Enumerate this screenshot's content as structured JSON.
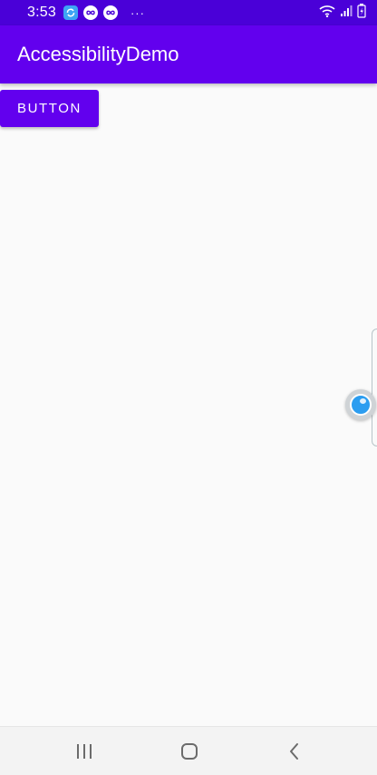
{
  "status_bar": {
    "time": "3:53",
    "more_glyph": "···",
    "icons": [
      "sync-icon",
      "infinity-icon",
      "infinity-icon",
      "wifi-icon",
      "signal-icon",
      "battery-icon"
    ]
  },
  "app_bar": {
    "title": "AccessibilityDemo"
  },
  "main": {
    "button_label": "BUTTON"
  },
  "nav_bar": {
    "items": [
      "recent-apps-icon",
      "home-icon",
      "back-icon"
    ]
  },
  "colors": {
    "status_bar": "#4a00d8",
    "app_bar": "#6200ee",
    "button": "#6200ee",
    "background": "#fafafa",
    "floating_ball": "#2b9df0"
  }
}
